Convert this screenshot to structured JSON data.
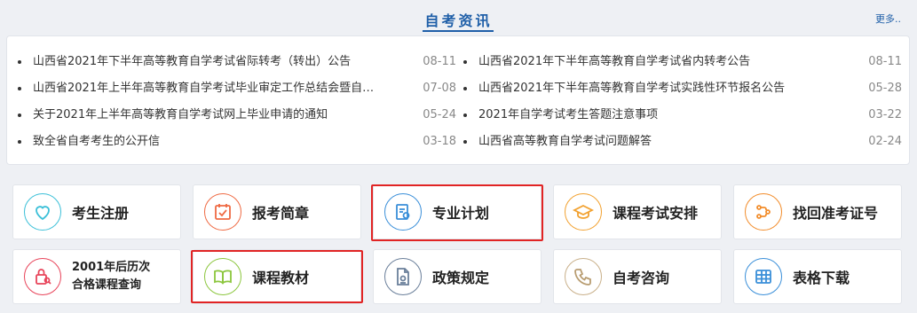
{
  "news": {
    "title": "自考资讯",
    "more": "更多..",
    "left": [
      {
        "text": "山西省2021年下半年高等教育自学考试省际转考（转出）公告",
        "date": "08-11"
      },
      {
        "text": "山西省2021年上半年高等教育自学考试毕业审定工作总结会暨自…",
        "date": "07-08"
      },
      {
        "text": "关于2021年上半年高等教育自学考试网上毕业申请的通知",
        "date": "05-24"
      },
      {
        "text": "致全省自考考生的公开信",
        "date": "03-18"
      }
    ],
    "right": [
      {
        "text": "山西省2021年下半年高等教育自学考试省内转考公告",
        "date": "08-11"
      },
      {
        "text": "山西省2021年下半年高等教育自学考试实践性环节报名公告",
        "date": "05-28"
      },
      {
        "text": "2021年自学考试考生答题注意事项",
        "date": "03-22"
      },
      {
        "text": "山西省高等教育自学考试问题解答",
        "date": "02-24"
      }
    ]
  },
  "services": [
    {
      "label": "考生注册",
      "icon": "heart-icon",
      "color": "#3cc0d8"
    },
    {
      "label": "报考简章",
      "icon": "calendar-check-icon",
      "color": "#ef6a43"
    },
    {
      "label": "专业计划",
      "icon": "document-plan-icon",
      "color": "#3a8fd9"
    },
    {
      "label": "课程考试安排",
      "icon": "graduation-cap-icon",
      "color": "#f2a12f"
    },
    {
      "label": "找回准考证号",
      "icon": "retrieve-flow-icon",
      "color": "#f28c2a"
    },
    {
      "label": "2001年后历次",
      "label2": "合格课程查询",
      "icon": "lock-search-icon",
      "color": "#e8445a"
    },
    {
      "label": "课程教材",
      "icon": "open-book-icon",
      "color": "#8cc63e"
    },
    {
      "label": "政策规定",
      "icon": "document-stamp-icon",
      "color": "#6a7f9a"
    },
    {
      "label": "自考咨询",
      "icon": "phone-icon",
      "color": "#c9b08a"
    },
    {
      "label": "表格下载",
      "icon": "table-grid-icon",
      "color": "#3a8fd9"
    }
  ],
  "colors": {
    "accent": "#1f5fa8",
    "highlight": "#e12424"
  }
}
